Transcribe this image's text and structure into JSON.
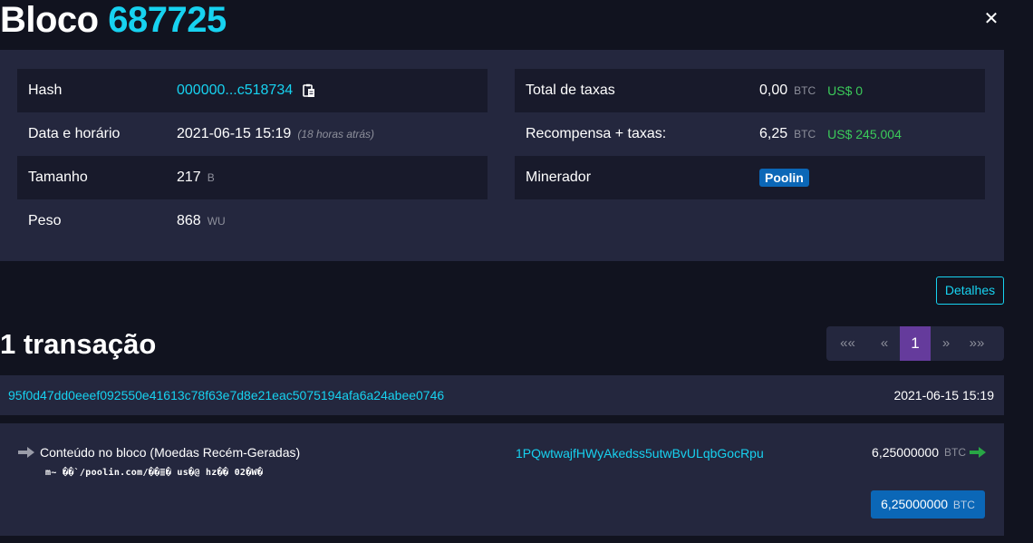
{
  "page": {
    "title_word": "Bloco",
    "block_number": "687725",
    "close_symbol": "✕"
  },
  "block_info": {
    "hash": {
      "label": "Hash",
      "value": "000000...c518734"
    },
    "datetime": {
      "label": "Data e horário",
      "value": "2021-06-15 15:19",
      "ago": "(18 horas atrás)"
    },
    "size": {
      "label": "Tamanho",
      "value": "217",
      "unit": "B"
    },
    "weight": {
      "label": "Peso",
      "value": "868",
      "unit": "WU"
    },
    "total_fees": {
      "label": "Total de taxas",
      "value": "0,00",
      "unit": "BTC",
      "usd": "US$ 0"
    },
    "reward": {
      "label": "Recompensa + taxas:",
      "value": "6,25",
      "unit": "BTC",
      "usd": "US$ 245.004"
    },
    "miner": {
      "label": "Minerador",
      "value": "Poolin"
    }
  },
  "details_button": "Detalhes",
  "transactions": {
    "title": "1 transação",
    "pagination": [
      "«« ",
      "«",
      "1",
      "»",
      "»»"
    ],
    "items": [
      {
        "txid": "95f0d47dd0eeef092550e41613c78f63e7d8e21eac5075194afa6a24abee0746",
        "time": "2021-06-15 15:19",
        "input_label": "Conteúdo no bloco (Moedas Recém-Geradas)",
        "coinbase_data": "m~  ��`/poolin.com/��≣� us�@ hz�� 02�W�",
        "address": "1PQwtwajfHWyAkedss5utwBvULqbGocRpu",
        "amount": "6,25000000",
        "unit": "BTC",
        "total": "6,25000000",
        "total_unit": "BTC"
      }
    ]
  },
  "colors": {
    "accent": "#17d2f0",
    "usd_green": "#3bcb5a",
    "badge_blue": "#0b67b7",
    "active_page": "#653b9c"
  },
  "icons": {
    "copy": "copy-icon",
    "arrow_in": "arrow-right-gray-icon",
    "arrow_out": "arrow-right-green-icon",
    "close": "close-icon"
  }
}
